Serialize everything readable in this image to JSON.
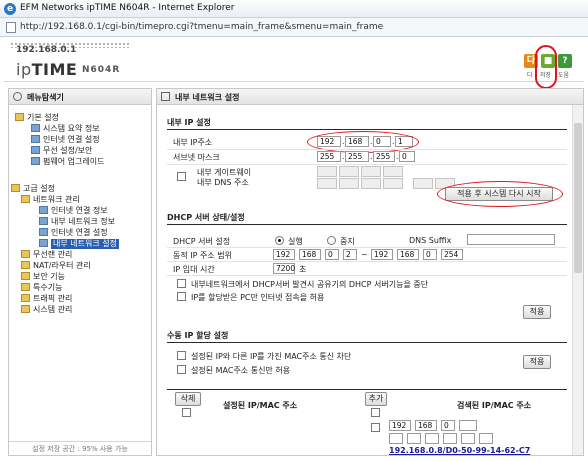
{
  "window": {
    "title": "EFM Networks ipTIME N604R - Internet Explorer",
    "url": "http://192.168.0.1/cgi-bin/timepro.cgi?tmenu=main_frame&smenu=main_frame"
  },
  "header": {
    "address": "192.168.0.1",
    "logo_prefix": "ip",
    "logo_main": "TIME",
    "model": "N604R",
    "buttons": [
      {
        "label": "다",
        "caption": "다",
        "color": "#e08a1e"
      },
      {
        "label": "■",
        "caption": "저장",
        "color": "#6aa832"
      },
      {
        "label": "?",
        "caption": "도움",
        "color": "#3a9a3a"
      }
    ]
  },
  "left_panel": {
    "title": "메뉴탐색기",
    "footer": "설정 저장 공간 : 95% 사용 가능",
    "basic_group": "기본 설정",
    "basic_items": [
      "시스템 요약 정보",
      "인터넷 연결 설정",
      "무선 설정/보안",
      "펌웨어 업그레이드"
    ],
    "advanced_group": "고급 설정",
    "network_group": "네트워크 관리",
    "network_items": [
      "인터넷 연결 정보",
      "내부 네트워크 정보",
      "인터넷 연결 설정",
      "내부 네트워크 설정"
    ],
    "other_items": [
      "무선랜 관리",
      "NAT/라우터 관리",
      "보안 기능",
      "특수기능",
      "트래픽 관리",
      "시스템 관리"
    ]
  },
  "right_panel": {
    "title": "내부 네트워크 설정",
    "internal_ip": {
      "section": "내부 IP 설정",
      "ip_label": "내부 IP주소",
      "ip": [
        "192",
        "168",
        "0",
        "1"
      ],
      "mask_label": "서브넷 마스크",
      "mask": [
        "255",
        "255",
        "255",
        "0"
      ],
      "gateway_label": "내부 게이트웨이",
      "dns_label": "내부 DNS 주소",
      "restart_button": "적용 후 시스템 다시 시작"
    },
    "dhcp": {
      "section": "DHCP 서버 상태/설정",
      "server_label": "DHCP 서버 설정",
      "on_label": "실행",
      "off_label": "중지",
      "dns_suffix_label": "DNS Suffix",
      "range_label": "동적 IP 주소 범위",
      "range_start": [
        "192",
        "168",
        "0",
        "2"
      ],
      "range_sep": "~",
      "range_end": [
        "192",
        "168",
        "0",
        "254"
      ],
      "lease_label": "IP 임대 시간",
      "lease_value": "7200",
      "lease_unit": "초",
      "opt1": "내부네트워크에서 DHCP서버 발견시 공유기의 DHCP 서버기능을 중단",
      "opt2": "IP를 할당받은 PC만 인터넷 접속을 허용",
      "apply_button": "적용"
    },
    "manual": {
      "section": "수동 IP 할당 설정",
      "opt1": "설정된 IP와 다른 IP를 가진 MAC주소 통신 차단",
      "opt2": "설정된 MAC주소 통신만 허용",
      "apply_button": "적용",
      "delete_button": "삭제",
      "configured_header": "설정된 IP/MAC 주소",
      "add_button": "추가",
      "searched_header": "검색된 IP/MAC 주소",
      "new_ip": [
        "192",
        "168",
        "0",
        ""
      ],
      "found_entry": "192.168.0.8/D0-50-99-14-62-C7"
    }
  }
}
